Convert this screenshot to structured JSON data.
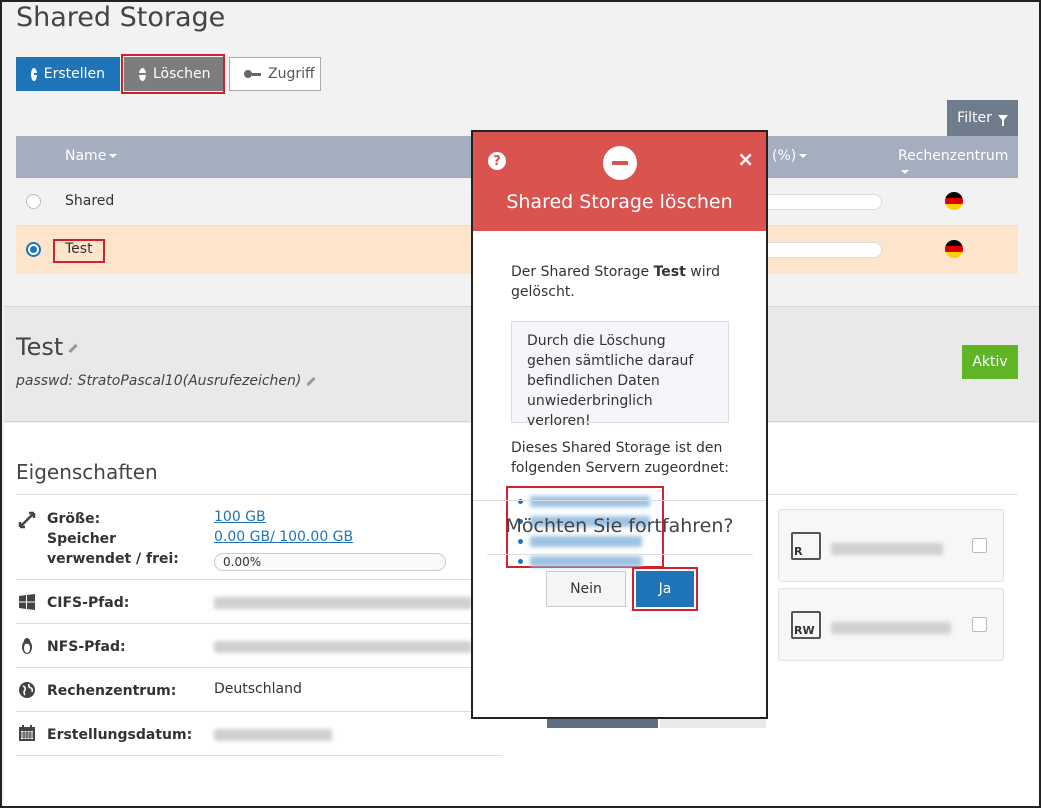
{
  "page_title": "Shared Storage",
  "toolbar": {
    "create_label": "Erstellen",
    "delete_label": "Löschen",
    "access_label": "Zugriff",
    "filter_label": "Filter"
  },
  "table": {
    "columns": [
      "Name",
      "(%)",
      "Rechenzentrum"
    ],
    "rows": [
      {
        "name": "Shared",
        "selected": false
      },
      {
        "name": "Test",
        "selected": true
      }
    ]
  },
  "detail": {
    "title": "Test",
    "subtitle": "passwd: StratoPascal10(Ausrufezeichen)",
    "status": "Aktiv"
  },
  "properties": {
    "title": "Eigenschaften",
    "size_label": "Größe:",
    "used_label": "Speicher verwendet / frei:",
    "size_value": "100 GB",
    "used_value": "0.00 GB/ 100.00 GB",
    "usage_percent": "0.00%",
    "cifs_label": "CIFS-Pfad:",
    "nfs_label": "NFS-Pfad:",
    "dc_label": "Rechenzentrum:",
    "dc_value": "Deutschland",
    "created_label": "Erstellungsdatum:"
  },
  "modal": {
    "title": "Shared Storage löschen",
    "msg_prefix": "Der Shared Storage ",
    "msg_name": "Test",
    "msg_suffix": " wird gelöscht.",
    "warning": "Durch die Löschung gehen sämtliche darauf befindlichen Daten unwiederbringlich verloren!",
    "assigned": "Dieses Shared Storage ist den folgenden Servern zugeordnet:",
    "question": "Möchten Sie fortfahren?",
    "no_label": "Nein",
    "yes_label": "Ja"
  },
  "colors": {
    "primary": "#1f74b8",
    "danger": "#d9534f",
    "success": "#5fb526",
    "highlight": "#d4202a"
  }
}
